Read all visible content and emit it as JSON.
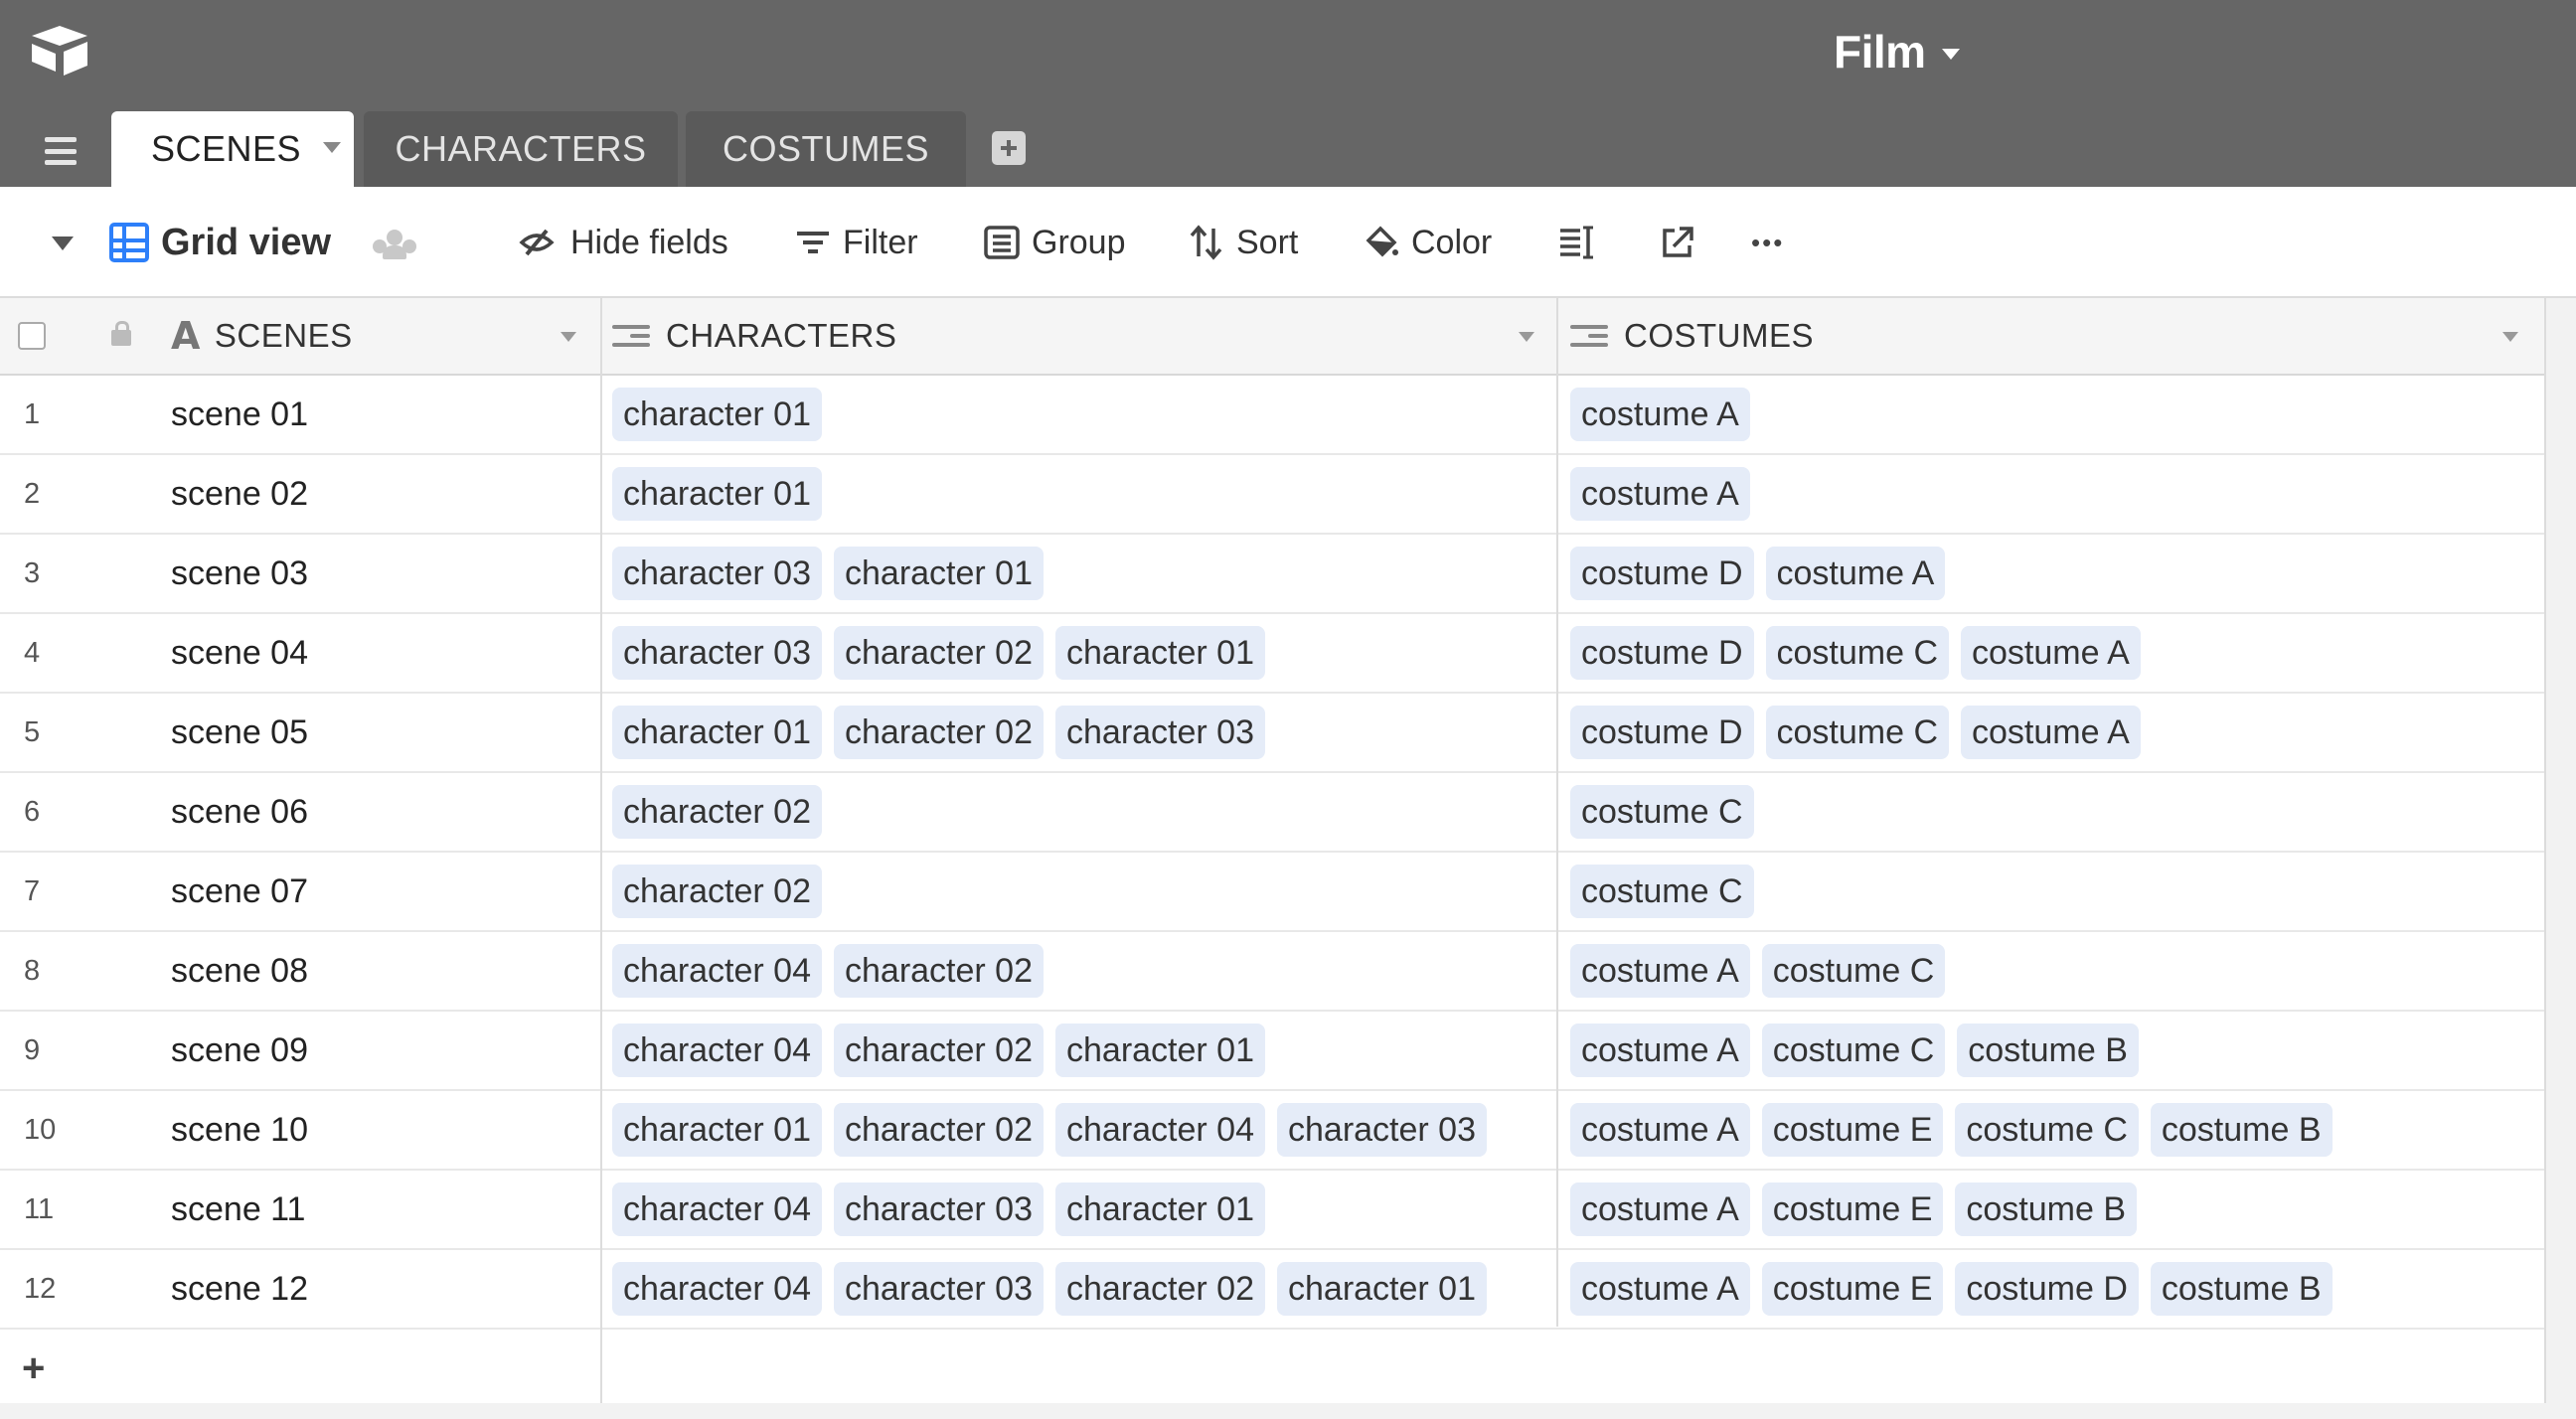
{
  "base": {
    "title": "Film"
  },
  "tabs": [
    {
      "label": "SCENES",
      "active": true
    },
    {
      "label": "CHARACTERS",
      "active": false
    },
    {
      "label": "COSTUMES",
      "active": false
    }
  ],
  "toolbar": {
    "view_name": "Grid view",
    "hide_fields": "Hide fields",
    "filter": "Filter",
    "group": "Group",
    "sort": "Sort",
    "color": "Color",
    "more": "•••"
  },
  "columns": [
    {
      "label": "SCENES",
      "icon": "text-field-icon"
    },
    {
      "label": "CHARACTERS",
      "icon": "linked-record-icon"
    },
    {
      "label": "COSTUMES",
      "icon": "linked-record-icon"
    }
  ],
  "rows": [
    {
      "num": "1",
      "scene": "scene 01",
      "characters": [
        "character 01"
      ],
      "costumes": [
        "costume A"
      ]
    },
    {
      "num": "2",
      "scene": "scene 02",
      "characters": [
        "character 01"
      ],
      "costumes": [
        "costume A"
      ]
    },
    {
      "num": "3",
      "scene": "scene 03",
      "characters": [
        "character 03",
        "character 01"
      ],
      "costumes": [
        "costume D",
        "costume A"
      ]
    },
    {
      "num": "4",
      "scene": "scene 04",
      "characters": [
        "character 03",
        "character 02",
        "character 01"
      ],
      "costumes": [
        "costume D",
        "costume C",
        "costume A"
      ]
    },
    {
      "num": "5",
      "scene": "scene 05",
      "characters": [
        "character 01",
        "character 02",
        "character 03"
      ],
      "costumes": [
        "costume D",
        "costume C",
        "costume A"
      ]
    },
    {
      "num": "6",
      "scene": "scene 06",
      "characters": [
        "character 02"
      ],
      "costumes": [
        "costume C"
      ]
    },
    {
      "num": "7",
      "scene": "scene 07",
      "characters": [
        "character 02"
      ],
      "costumes": [
        "costume C"
      ]
    },
    {
      "num": "8",
      "scene": "scene 08",
      "characters": [
        "character 04",
        "character 02"
      ],
      "costumes": [
        "costume A",
        "costume C"
      ]
    },
    {
      "num": "9",
      "scene": "scene 09",
      "characters": [
        "character 04",
        "character 02",
        "character 01"
      ],
      "costumes": [
        "costume A",
        "costume C",
        "costume B"
      ]
    },
    {
      "num": "10",
      "scene": "scene 10",
      "characters": [
        "character 01",
        "character 02",
        "character 04",
        "character 03"
      ],
      "costumes": [
        "costume A",
        "costume E",
        "costume C",
        "costume B"
      ]
    },
    {
      "num": "11",
      "scene": "scene 11",
      "characters": [
        "character 04",
        "character 03",
        "character 01"
      ],
      "costumes": [
        "costume A",
        "costume E",
        "costume B"
      ]
    },
    {
      "num": "12",
      "scene": "scene 12",
      "characters": [
        "character 04",
        "character 03",
        "character 02",
        "character 01"
      ],
      "costumes": [
        "costume A",
        "costume E",
        "costume D",
        "costume B"
      ]
    }
  ],
  "add_row_label": "+",
  "colors": {
    "header_bg": "#666666",
    "chip_bg": "#e5ecf8",
    "accent": "#2d7ff9"
  }
}
